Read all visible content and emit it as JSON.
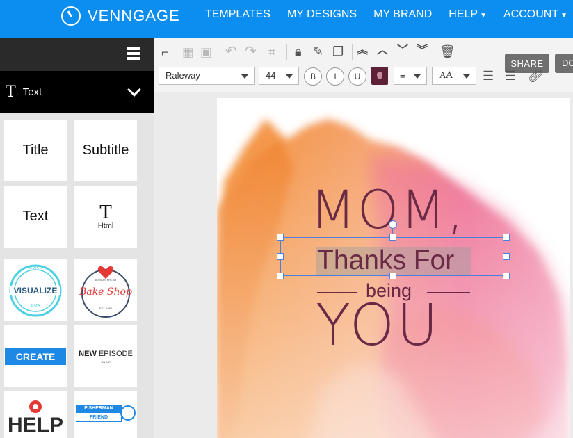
{
  "brand": {
    "name": "VENNGAGE"
  },
  "nav": {
    "templates": "TEMPLATES",
    "my_designs": "MY DESIGNS",
    "my_brand": "MY BRAND",
    "help": "HELP",
    "account": "ACCOUNT"
  },
  "sidebar": {
    "category": "Text",
    "tiles": {
      "title": "Title",
      "subtitle": "Subtitle",
      "text": "Text",
      "html_icon": "T",
      "html": "Html",
      "visualize": "VISUALIZE",
      "visualize_small_top": "SIMPLE",
      "visualize_small_bottom": "DATA",
      "bake_shop": "Bake Shop",
      "bake_small_top": "ALWAYS FRESH",
      "bake_small_bottom": "EST. 1990",
      "create": "CREATE",
      "new_episode_bold": "NEW",
      "new_episode_rest": "EPISODE",
      "new_episode_sub": "ON AIR",
      "help": "HELP",
      "fisherman_top": "FISHERMAN",
      "fisherman_bottom": "FRIEND"
    }
  },
  "toolbar": {
    "font_family": "Raleway",
    "font_size": "44",
    "bold": "B",
    "italic": "I",
    "underline": "U",
    "share": "SHARE",
    "download_partial": "DO",
    "text_color": "#5c2136"
  },
  "canvas": {
    "line1": "MOM,",
    "line2": "Thanks For",
    "line3": "being",
    "line4": "YOU",
    "text_color": "#6a2a45"
  },
  "icons": {
    "format_painter": "format-painter-icon",
    "transparency": "transparency-icon",
    "image": "image-icon",
    "undo": "undo-icon",
    "redo": "redo-icon",
    "crop": "crop-icon",
    "lock": "lock-icon",
    "edit": "edit-icon",
    "duplicate": "duplicate-icon",
    "bring_to_front": "bring-to-front-icon",
    "bring_forward": "bring-forward-icon",
    "send_backward": "send-backward-icon",
    "send_to_back": "send-to-back-icon",
    "delete": "trash-icon",
    "align": "align-center-icon",
    "text_size": "text-size-icon",
    "numbered_list": "numbered-list-icon",
    "bulleted_list": "bulleted-list-icon",
    "link": "link-icon"
  }
}
